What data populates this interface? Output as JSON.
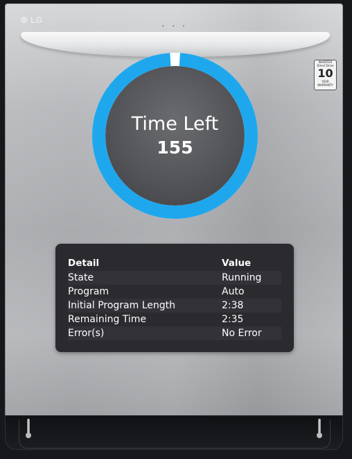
{
  "brand": {
    "logo": "LG"
  },
  "badge": {
    "line1": "INVERTER",
    "line2": "Direct Drive",
    "big": "10",
    "line3": "YEAR",
    "line4": "WARRANTY"
  },
  "gauge": {
    "title": "Time Left",
    "value": "155",
    "fraction": 0.98,
    "color": "#1fa7ee",
    "track_color": "#ffffff"
  },
  "details": {
    "headers": {
      "detail": "Detail",
      "value": "Value"
    },
    "rows": [
      {
        "detail": "State",
        "value": "Running"
      },
      {
        "detail": "Program",
        "value": "Auto"
      },
      {
        "detail": "Initial Program Length",
        "value": "2:38"
      },
      {
        "detail": "Remaining Time",
        "value": "2:35"
      },
      {
        "detail": "Error(s)",
        "value": "No Error"
      }
    ]
  }
}
